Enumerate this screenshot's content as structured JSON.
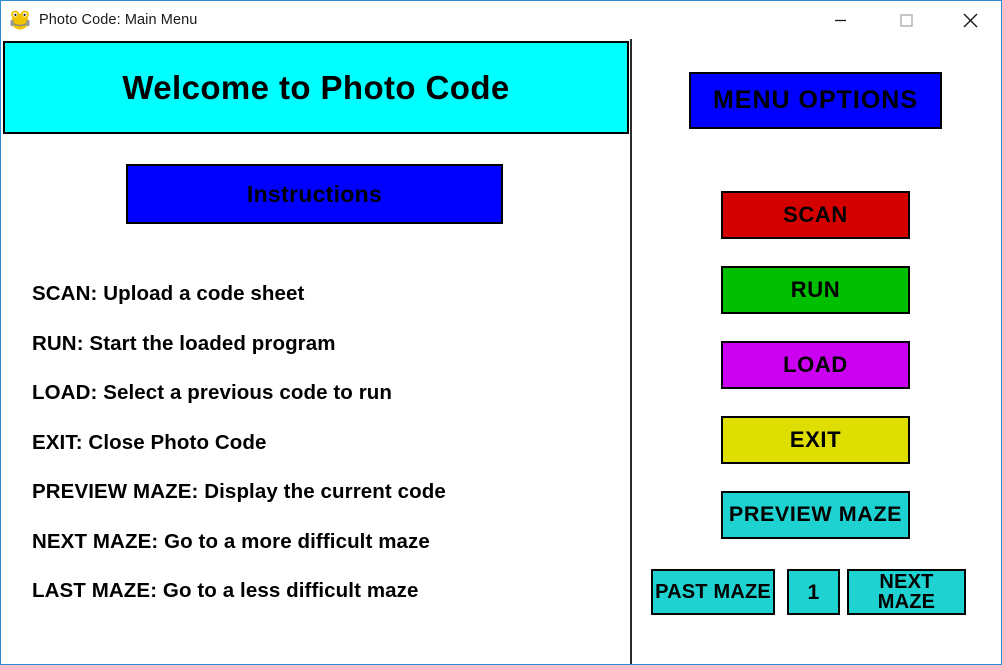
{
  "window": {
    "title": "Photo Code: Main Menu",
    "icon": "app-frog-icon",
    "controls": {
      "minimize": "minimize-icon",
      "maximize": "maximize-icon",
      "close": "close-icon"
    },
    "border_color": "#2a8ad4"
  },
  "left_panel": {
    "banner": {
      "text": "Welcome to Photo Code",
      "bg_color": "#00FFFF",
      "text_color": "#000000"
    },
    "instructions_button": {
      "label": "Instructions",
      "bg_color": "#0000FF",
      "text_color": "#000000"
    },
    "instructions": [
      "SCAN: Upload a code sheet",
      "RUN: Start the loaded program",
      "LOAD: Select a previous code to run",
      "EXIT: Close Photo Code",
      "PREVIEW MAZE: Display the current code",
      "NEXT MAZE: Go to a more difficult maze",
      "LAST MAZE: Go to a less difficult maze"
    ]
  },
  "right_panel": {
    "header": {
      "label": "MENU OPTIONS",
      "bg_color": "#0000FF",
      "text_color": "#000000"
    },
    "buttons": [
      {
        "label": "SCAN",
        "bg_color": "#D40000"
      },
      {
        "label": "RUN",
        "bg_color": "#00BF00"
      },
      {
        "label": "LOAD",
        "bg_color": "#CC00F0"
      },
      {
        "label": "EXIT",
        "bg_color": "#DEDE00"
      },
      {
        "label": "PREVIEW MAZE",
        "bg_color": "#1FD2D2"
      }
    ],
    "maze_nav": {
      "past_label": "PAST MAZE",
      "maze_number": "1",
      "next_label": "NEXT MAZE",
      "bg_color": "#1FD2D2"
    }
  }
}
